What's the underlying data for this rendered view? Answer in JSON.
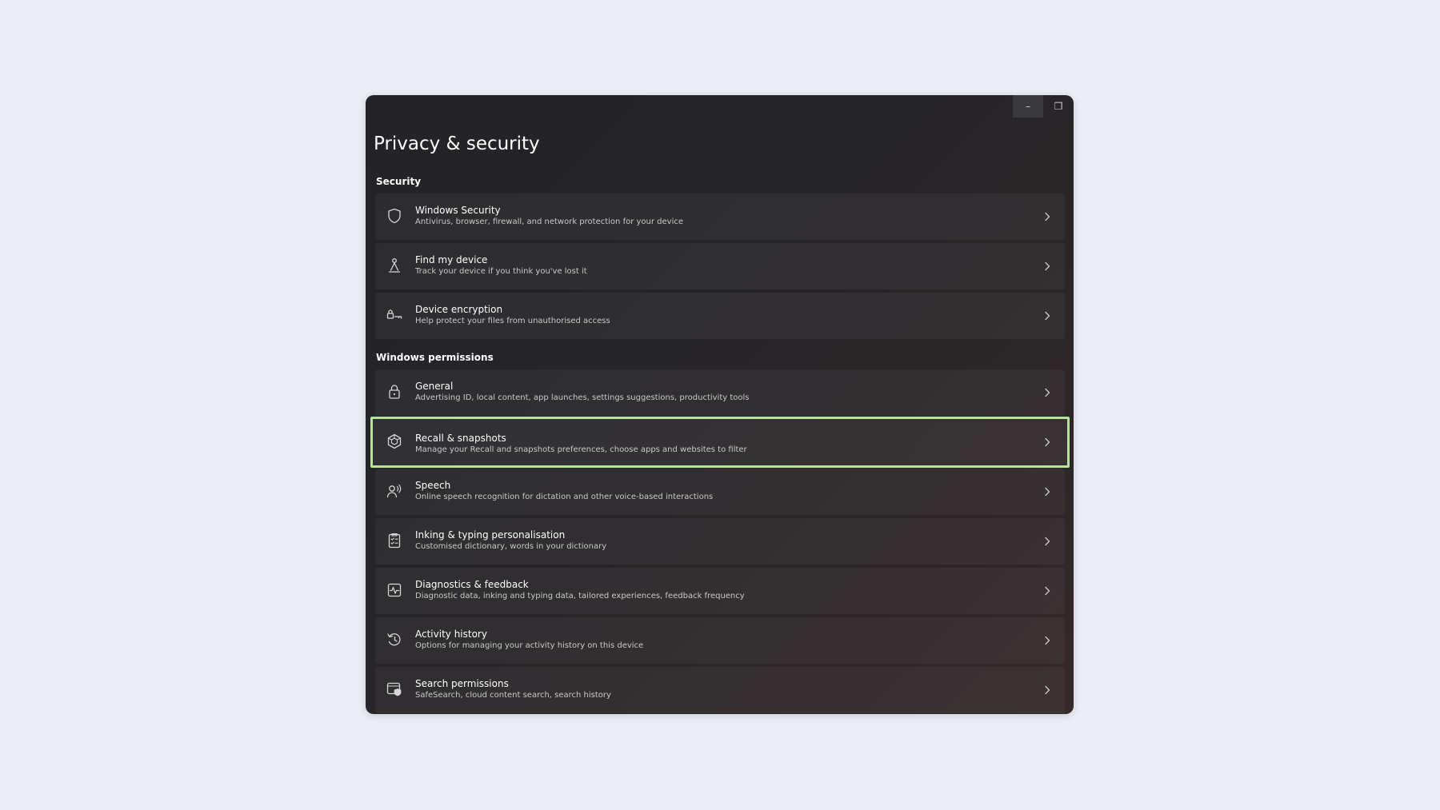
{
  "window": {
    "controls": {
      "minimize": "–",
      "restore": "❐"
    }
  },
  "page": {
    "title": "Privacy & security"
  },
  "sections": [
    {
      "label": "Security",
      "items": [
        {
          "title": "Windows Security",
          "desc": "Antivirus, browser, firewall, and network protection for your device",
          "icon": "shield-icon"
        },
        {
          "title": "Find my device",
          "desc": "Track your device if you think you've lost it",
          "icon": "person-pin-icon"
        },
        {
          "title": "Device encryption",
          "desc": "Help protect your files from unauthorised access",
          "icon": "encryption-key-icon"
        }
      ]
    },
    {
      "label": "Windows permissions",
      "items": [
        {
          "title": "General",
          "desc": "Advertising ID, local content, app launches, settings suggestions, productivity tools",
          "icon": "lock-icon"
        },
        {
          "title": "Recall & snapshots",
          "desc": "Manage your Recall and snapshots preferences, choose apps and websites to filter",
          "icon": "recall-icon",
          "highlighted": true
        },
        {
          "title": "Speech",
          "desc": "Online speech recognition for dictation and other voice-based interactions",
          "icon": "speech-icon"
        },
        {
          "title": "Inking & typing personalisation",
          "desc": "Customised dictionary, words in your dictionary",
          "icon": "dictionary-icon"
        },
        {
          "title": "Diagnostics & feedback",
          "desc": "Diagnostic data, inking and typing data, tailored experiences, feedback frequency",
          "icon": "diagnostics-icon"
        },
        {
          "title": "Activity history",
          "desc": "Options for managing your activity history on this device",
          "icon": "history-icon"
        },
        {
          "title": "Search permissions",
          "desc": "SafeSearch, cloud content search, search history",
          "icon": "search-permissions-icon"
        }
      ]
    }
  ],
  "colors": {
    "highlight": "#b6e39a",
    "text": "#ffffff",
    "subtext": "#c9c9c9",
    "page_background": "#eceef6"
  }
}
